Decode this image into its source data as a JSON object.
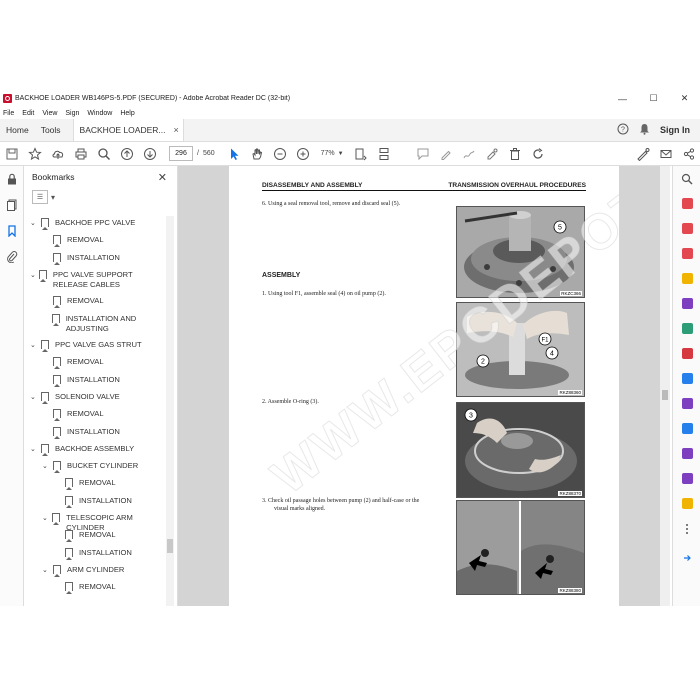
{
  "window": {
    "title": "BACKHOE LOADER WB146PS-5.PDF (SECURED) - Adobe Acrobat Reader DC (32-bit)",
    "minimize": "—",
    "maximize": "☐",
    "close": "✕"
  },
  "menu": [
    "File",
    "Edit",
    "View",
    "Sign",
    "Window",
    "Help"
  ],
  "tabs": {
    "home": "Home",
    "tools": "Tools",
    "document": "BACKHOE LOADER...",
    "close": "×",
    "sign_in": "Sign In"
  },
  "toolbar": {
    "current_page": "296",
    "page_separator": "/",
    "total_pages": "560",
    "zoom": "77%"
  },
  "bookmarks": {
    "title": "Bookmarks",
    "items": [
      {
        "label": "BACKHOE PPC VALVE",
        "level": 0,
        "expanded": true
      },
      {
        "label": "REMOVAL",
        "level": 1
      },
      {
        "label": "INSTALLATION",
        "level": 1
      },
      {
        "label": "PPC VALVE SUPPORT RELEASE CABLES",
        "level": 0,
        "expanded": true
      },
      {
        "label": "REMOVAL",
        "level": 1
      },
      {
        "label": "INSTALLATION AND ADJUSTING",
        "level": 1
      },
      {
        "label": "PPC VALVE GAS STRUT",
        "level": 0,
        "expanded": true
      },
      {
        "label": "REMOVAL",
        "level": 1
      },
      {
        "label": "INSTALLATION",
        "level": 1
      },
      {
        "label": "SOLENOID VALVE",
        "level": 0,
        "expanded": true
      },
      {
        "label": "REMOVAL",
        "level": 1
      },
      {
        "label": "INSTALLATION",
        "level": 1
      },
      {
        "label": "BACKHOE ASSEMBLY",
        "level": 0,
        "expanded": true
      },
      {
        "label": "BUCKET CYLINDER",
        "level": 1,
        "expanded": true
      },
      {
        "label": "REMOVAL",
        "level": 2
      },
      {
        "label": "INSTALLATION",
        "level": 2
      },
      {
        "label": "TELESCOPIC ARM CYLINDER",
        "level": 1,
        "expanded": true
      },
      {
        "label": "REMOVAL",
        "level": 2
      },
      {
        "label": "INSTALLATION",
        "level": 2
      },
      {
        "label": "ARM CYLINDER",
        "level": 1,
        "expanded": true
      },
      {
        "label": "REMOVAL",
        "level": 2
      }
    ]
  },
  "document": {
    "header_left": "DISASSEMBLY AND ASSEMBLY",
    "header_right": "TRANSMISSION OVERHAUL PROCEDURES",
    "step6": "6.    Using a seal removal tool, remove and discard seal (5).",
    "section": "ASSEMBLY",
    "step1": "1.    Using tool F1, assemble seal (4) on oil pump (2).",
    "step2": "2.    Assemble O-ring (3).",
    "step3a": "3.    Check oil passage holes between pump (2) and half-case or the",
    "step3b": "visual marks aligned.",
    "fig1_caption": "RKZC366",
    "fig1_callout": "5",
    "fig2_caption": "RKZ88360",
    "fig2_callouts": [
      "F1",
      "2",
      "4"
    ],
    "fig3_caption": "RKZ88370",
    "fig3_callout": "3",
    "fig4_caption": "RKZ88380",
    "watermark": "WWW.EPCDEPOT.COM"
  }
}
